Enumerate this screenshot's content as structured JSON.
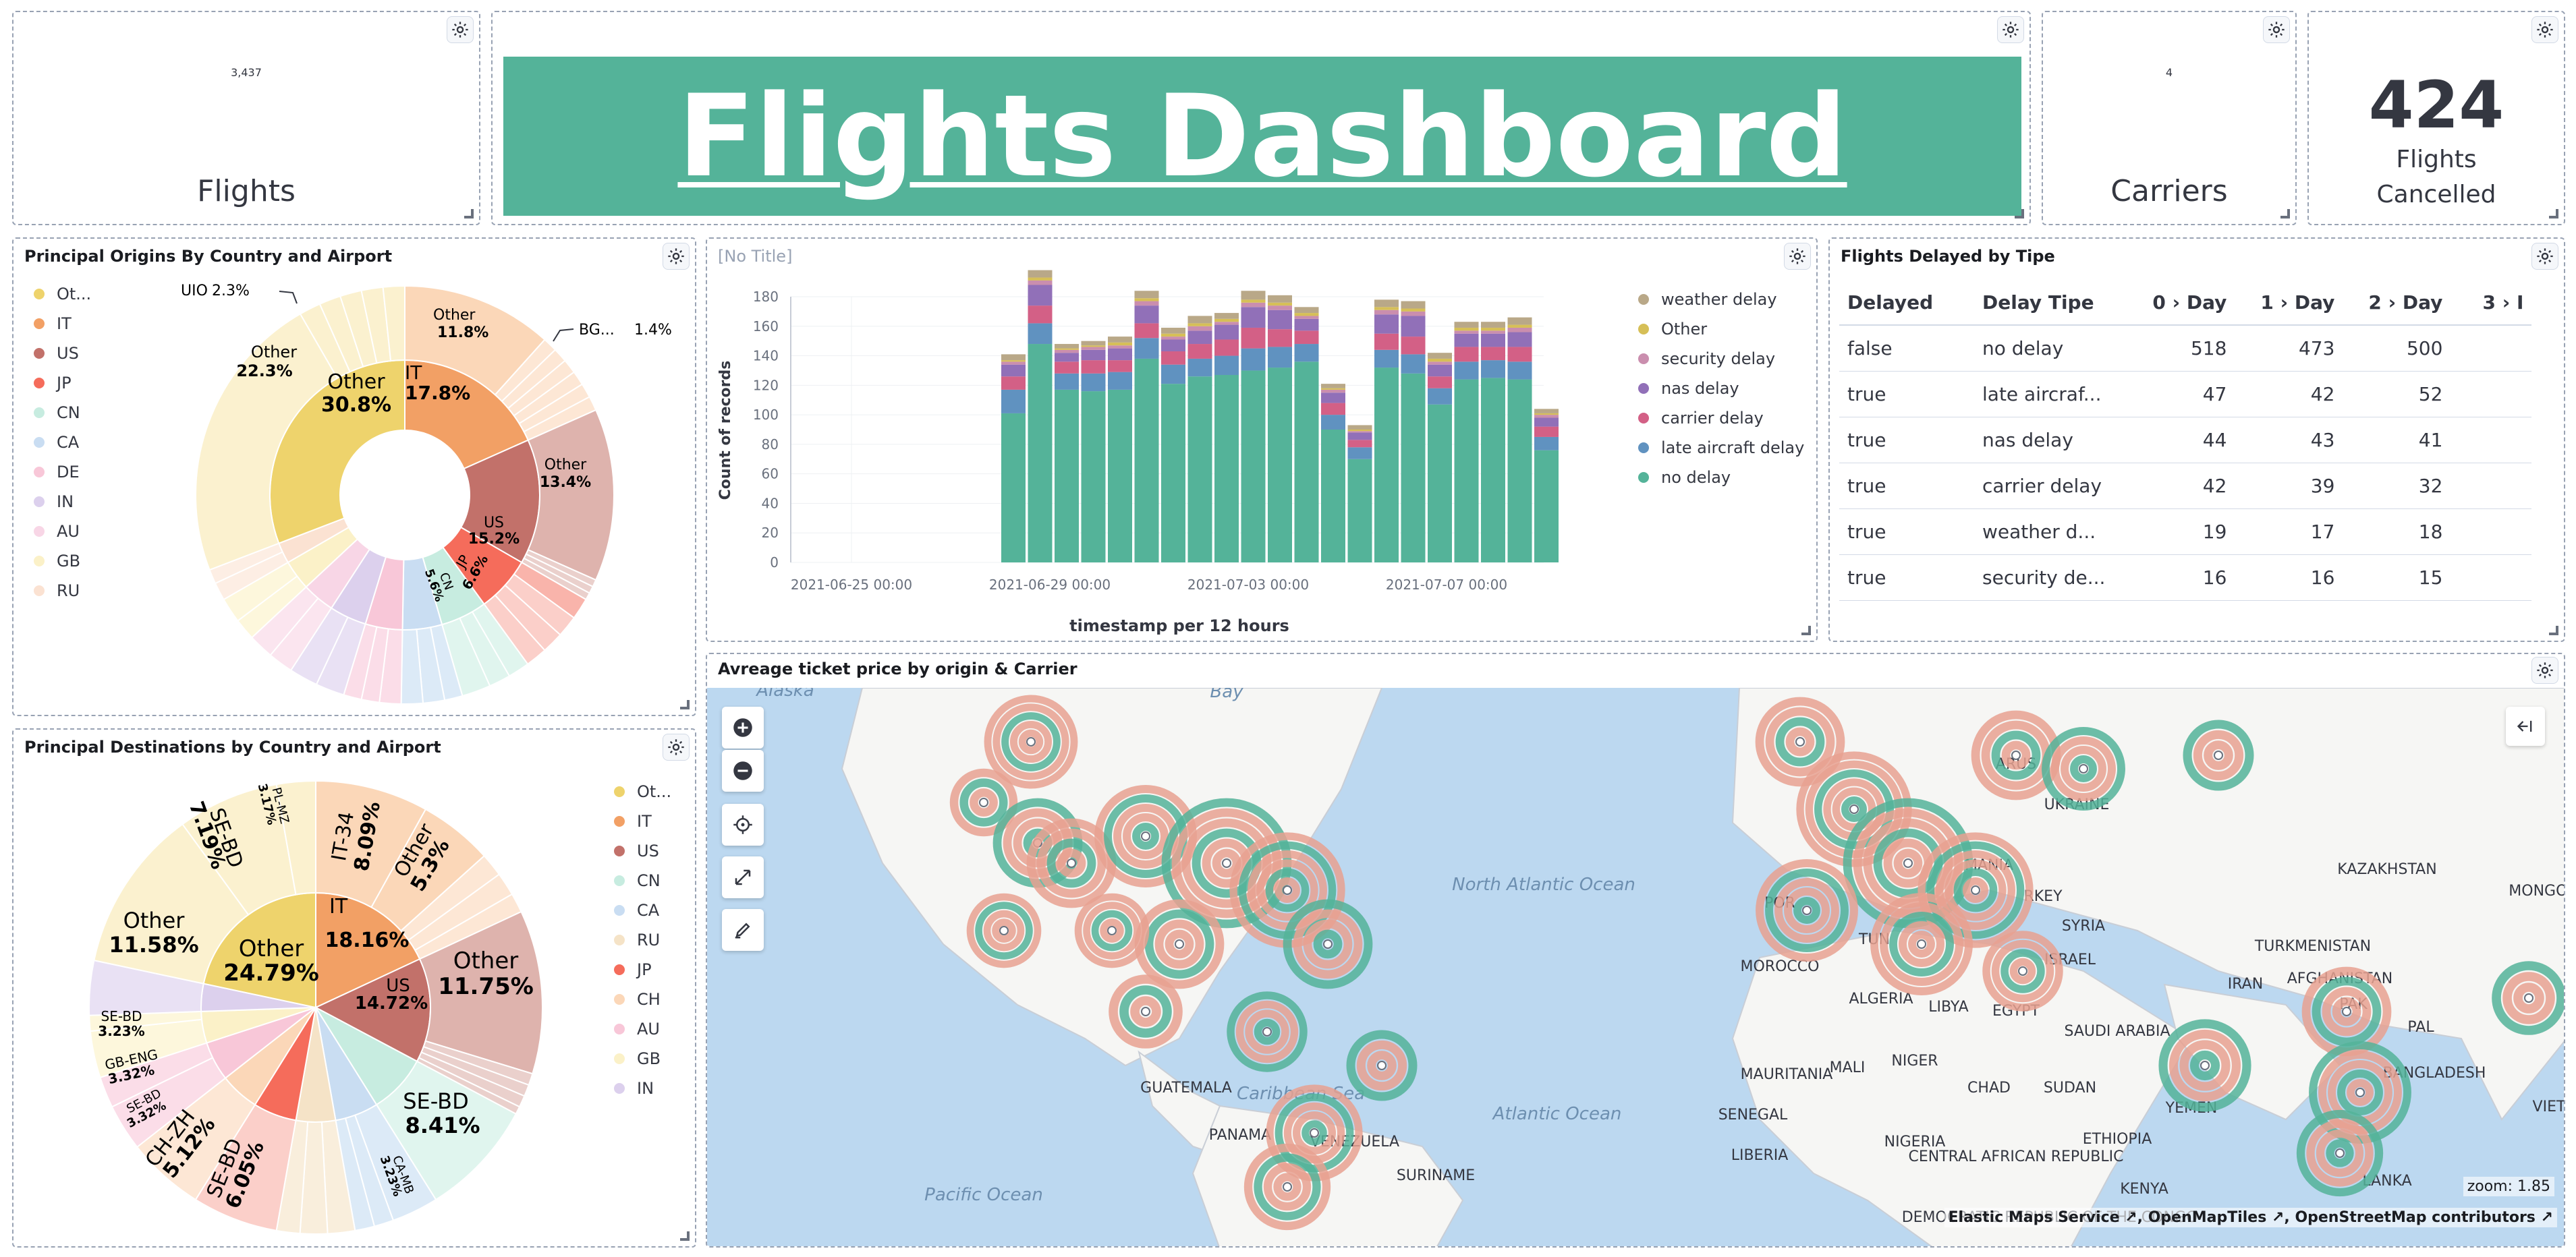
{
  "metrics": {
    "flights": {
      "value": "3,437",
      "label": "Flights"
    },
    "carriers": {
      "value": "4",
      "label": "Carriers"
    },
    "cancelled": {
      "value": "424",
      "label_line1": "Flights",
      "label_line2": "Cancelled"
    }
  },
  "banner": {
    "title": "Flights Dashboard",
    "color": "#54b399"
  },
  "origins": {
    "title": "Principal Origins By Country and Airport",
    "legend": [
      "Ot...",
      "IT",
      "US",
      "JP",
      "CN",
      "CA",
      "DE",
      "IN",
      "AU",
      "GB",
      "RU"
    ],
    "legend_colors": [
      "#eed36c",
      "#f2a065",
      "#c2716a",
      "#f56c5b",
      "#c7ece0",
      "#c9ddf2",
      "#f8c7d8",
      "#dcd0ed",
      "#f8d6e6",
      "#fbf1c8",
      "#fbe2d2"
    ],
    "labels": {
      "inner_other": "Other",
      "inner_other_pct": "30.8%",
      "it": "IT",
      "it_pct": "17.8%",
      "us": "US",
      "us_pct": "15.2%",
      "jp": "JP",
      "jp_pct": "6.6%",
      "cn": "CN",
      "cn_pct": "5.6%",
      "outer_other1": "Other",
      "outer_other1_pct": "11.8%",
      "outer_other2": "Other",
      "outer_other2_pct": "13.4%",
      "outer_other3": "Other",
      "outer_other3_pct": "22.3%",
      "uio": "UIO",
      "uio_pct": "2.3%",
      "bg": "BG...",
      "bg_pct": "1.4%"
    }
  },
  "destinations": {
    "title": "Principal Destinations by Country and Airport",
    "legend": [
      "Ot...",
      "IT",
      "US",
      "CN",
      "CA",
      "RU",
      "JP",
      "CH",
      "AU",
      "GB",
      "IN"
    ],
    "legend_colors": [
      "#eed36c",
      "#f2a065",
      "#c2716a",
      "#c7ece0",
      "#c9ddf2",
      "#f5e3c7",
      "#f56c5b",
      "#fbd7b8",
      "#f8c7d8",
      "#fbf1c8",
      "#dcd0ed"
    ],
    "labels": {
      "inner_other": "Other",
      "inner_other_pct": "24.79%",
      "it": "IT",
      "it_pct": "18.16%",
      "us": "US",
      "us_pct": "14.72%",
      "it34": "IT-34",
      "it34_pct": "8.09%",
      "o53": "Other",
      "o53_pct": "5.3%",
      "o1175": "Other",
      "o1175_pct": "11.75%",
      "sebd841": "SE-BD",
      "sebd841_pct": "8.41%",
      "camb": "CA-MB",
      "camb_pct": "3.23%",
      "sebd605": "SE-BD",
      "sebd605_pct": "6.05%",
      "chzh": "CH-ZH",
      "chzh_pct": "5.12%",
      "sebd332": "SE-BD",
      "sebd332_pct": "3.32%",
      "gbeng": "GB-ENG",
      "gbeng_pct": "3.32%",
      "sebd323": "SE-BD",
      "sebd323_pct": "3.23%",
      "o1158": "Other",
      "o1158_pct": "11.58%",
      "sebd719": "SE-BD",
      "sebd719_pct": "7.19%",
      "plmz": "PL-MZ",
      "plmz_pct": "3.17%"
    }
  },
  "chart_data": {
    "type": "bar",
    "title": "[No Title]",
    "xlabel": "timestamp per 12 hours",
    "ylabel": "Count of records",
    "ylim": [
      0,
      180
    ],
    "yticks": [
      "0",
      "20",
      "40",
      "60",
      "80",
      "100",
      "120",
      "140",
      "160",
      "180"
    ],
    "xticks": [
      "2021-06-25 00:00",
      "2021-06-29 00:00",
      "2021-07-03 00:00",
      "2021-07-07 00:00"
    ],
    "legend_position": "right",
    "series": [
      {
        "name": "no delay",
        "color": "#54b399",
        "values": [
          101,
          148,
          117,
          116,
          117,
          138,
          121,
          126,
          127,
          130,
          132,
          136,
          90,
          70,
          132,
          128,
          107,
          124,
          125,
          124,
          76
        ]
      },
      {
        "name": "late aircraft delay",
        "color": "#6092c0",
        "values": [
          16,
          14,
          11,
          12,
          12,
          14,
          13,
          12,
          13,
          15,
          14,
          12,
          10,
          8,
          12,
          13,
          11,
          12,
          12,
          12,
          9
        ]
      },
      {
        "name": "carrier delay",
        "color": "#d36086",
        "values": [
          9,
          12,
          8,
          9,
          8,
          10,
          9,
          10,
          11,
          14,
          12,
          9,
          8,
          5,
          11,
          12,
          8,
          10,
          9,
          10,
          7
        ]
      },
      {
        "name": "nas delay",
        "color": "#9170b8",
        "values": [
          8,
          14,
          6,
          7,
          8,
          12,
          8,
          9,
          10,
          14,
          13,
          8,
          7,
          5,
          13,
          14,
          8,
          9,
          9,
          10,
          6
        ]
      },
      {
        "name": "security delay",
        "color": "#ca8eae",
        "values": [
          2,
          3,
          2,
          2,
          2,
          3,
          2,
          3,
          2,
          3,
          3,
          2,
          2,
          1,
          3,
          3,
          2,
          2,
          2,
          3,
          2
        ]
      },
      {
        "name": "Other",
        "color": "#d6bf57",
        "values": [
          1,
          2,
          1,
          1,
          2,
          2,
          2,
          2,
          2,
          2,
          2,
          2,
          1,
          1,
          2,
          2,
          2,
          2,
          2,
          2,
          1
        ]
      },
      {
        "name": "weather delay",
        "color": "#b9a888",
        "values": [
          4,
          5,
          3,
          3,
          4,
          5,
          4,
          5,
          4,
          6,
          5,
          4,
          3,
          3,
          5,
          5,
          4,
          4,
          4,
          5,
          3
        ]
      }
    ]
  },
  "legend_order": [
    "weather delay",
    "Other",
    "security delay",
    "nas delay",
    "carrier delay",
    "late aircraft delay",
    "no delay"
  ],
  "delayed_table": {
    "title": "Flights Delayed by Tipe",
    "headers": [
      "Delayed",
      "Delay Tipe",
      "0 › Day",
      "1 › Day",
      "2 › Day",
      "3 › I"
    ],
    "rows": [
      [
        "false",
        "no delay",
        "518",
        "473",
        "500"
      ],
      [
        "true",
        "late aircraf...",
        "47",
        "42",
        "52"
      ],
      [
        "true",
        "nas delay",
        "44",
        "43",
        "41"
      ],
      [
        "true",
        "carrier delay",
        "42",
        "39",
        "32"
      ],
      [
        "true",
        "weather d...",
        "19",
        "17",
        "18"
      ],
      [
        "true",
        "security de...",
        "16",
        "16",
        "15"
      ]
    ]
  },
  "map": {
    "title": "Avreage ticket price by origin & Carrier",
    "zoom_label": "zoom: 1.85",
    "attribution": [
      "Elastic Maps Service",
      "OpenMapTiles",
      "OpenStreetMap contributors"
    ],
    "labels": [
      "Alaska",
      "Bay",
      "North Atlantic Ocean",
      "Atlantic Ocean",
      "Pacific Ocean",
      "Caribbean Sea",
      "GUATEMALA",
      "PANAMA",
      "VENEZUELA",
      "SURINAME",
      "MOROCCO",
      "ALGERIA",
      "LIBYA",
      "EGYPT",
      "MAURITANIA",
      "MALI",
      "NIGER",
      "CHAD",
      "SUDAN",
      "SENEGAL",
      "NIGERIA",
      "LIBERIA",
      "CENTRAL AFRICAN REPUBLIC",
      "ETHIOPIA",
      "KENYA",
      "DEMOCRATIC REPUBLIC OF THE CONGO",
      "YEMEN",
      "SAUDI ARABIA",
      "IRAN",
      "AFGHANISTAN",
      "TURKMENISTAN",
      "KAZAKHSTAN",
      "MONGOL",
      "UKRAINE",
      "ARUS",
      "MANIA",
      "RKEY",
      "SYRIA",
      "ISRAEL",
      "PAK",
      "PAL",
      "BANGLADESH",
      "LANKA",
      "VIET",
      "POR",
      "TUN"
    ],
    "ocean_color": "#bcd8f0",
    "land_color": "#f6f6f4"
  }
}
